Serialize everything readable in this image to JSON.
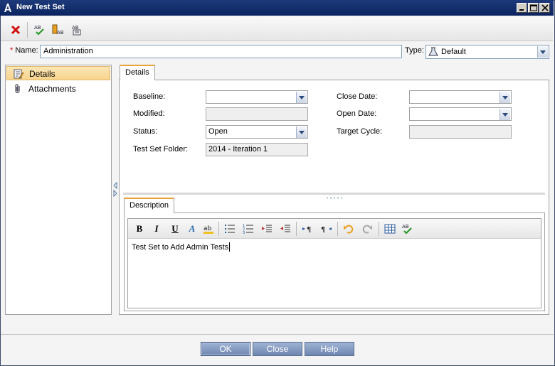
{
  "window": {
    "title": "New Test Set"
  },
  "toolbar": {
    "items": [
      {
        "name": "delete-icon"
      },
      {
        "name": "spell-check-icon"
      },
      {
        "name": "thesaurus-icon"
      },
      {
        "name": "spelling-options-icon"
      }
    ]
  },
  "form": {
    "name_required_marker": "*",
    "name_label": "Name:",
    "name_value": "Administration",
    "type_label": "Type:",
    "type_value": "Default"
  },
  "sidebar": {
    "items": [
      {
        "label": "Details",
        "icon": "details-icon",
        "selected": true
      },
      {
        "label": "Attachments",
        "icon": "paperclip-icon",
        "selected": false
      }
    ]
  },
  "details": {
    "tab_label": "Details",
    "fields": {
      "baseline_label": "Baseline:",
      "baseline_value": "",
      "modified_label": "Modified:",
      "modified_value": "",
      "status_label": "Status:",
      "status_value": "Open",
      "folder_label": "Test Set Folder:",
      "folder_value": "2014 - Iteration 1",
      "close_date_label": "Close Date:",
      "close_date_value": "",
      "open_date_label": "Open Date:",
      "open_date_value": "",
      "target_cycle_label": "Target Cycle:",
      "target_cycle_value": ""
    }
  },
  "description": {
    "tab_label": "Description",
    "text": "Test Set to Add Admin Tests",
    "toolbar": {
      "bold": "B",
      "italic": "I",
      "underline": "U",
      "font_color": "A"
    }
  },
  "footer": {
    "ok_label": "OK",
    "close_label": "Close",
    "help_label": "Help"
  },
  "colors": {
    "titlebar": "#0b2460",
    "selected_nav": "#f7d58d",
    "tab_accent": "#e8a33a",
    "button": "#6f86b0"
  }
}
